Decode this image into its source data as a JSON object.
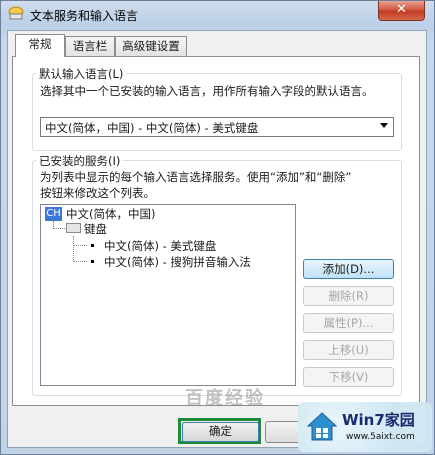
{
  "window": {
    "title": "文本服务和输入语言",
    "close_label": "✕"
  },
  "tabs": [
    {
      "label": "常规",
      "active": true
    },
    {
      "label": "语言栏",
      "active": false
    },
    {
      "label": "高级键设置",
      "active": false
    }
  ],
  "default_language": {
    "group_label": "默认输入语言(L)",
    "description": "选择其中一个已安装的输入语言，用作所有输入字段的默认语言。",
    "selected": "中文(简体，中国) - 中文(简体) - 美式键盘"
  },
  "installed_services": {
    "group_label": "已安装的服务(I)",
    "description_line1": "为列表中显示的每个输入语言选择服务。使用“添加”和“删除”",
    "description_line2": "按钮来修改这个列表。",
    "tree": {
      "language_badge": "CH",
      "language": "中文(简体，中国)",
      "category": "键盘",
      "items": [
        "中文(简体) - 美式键盘",
        "中文(简体) - 搜狗拼音输入法"
      ]
    }
  },
  "buttons": {
    "add": "添加(D)...",
    "remove": "删除(R)",
    "properties": "属性(P)...",
    "move_up": "上移(U)",
    "move_down": "下移(V)",
    "ok": "确定"
  },
  "watermark": {
    "brand": "Win7家园",
    "url": "www.5aixt.com",
    "overlay_text": "百度经验"
  },
  "colors": {
    "accent": "#3b78d8",
    "ok_highlight": "#1f8a3a",
    "close": "#c23a22"
  }
}
